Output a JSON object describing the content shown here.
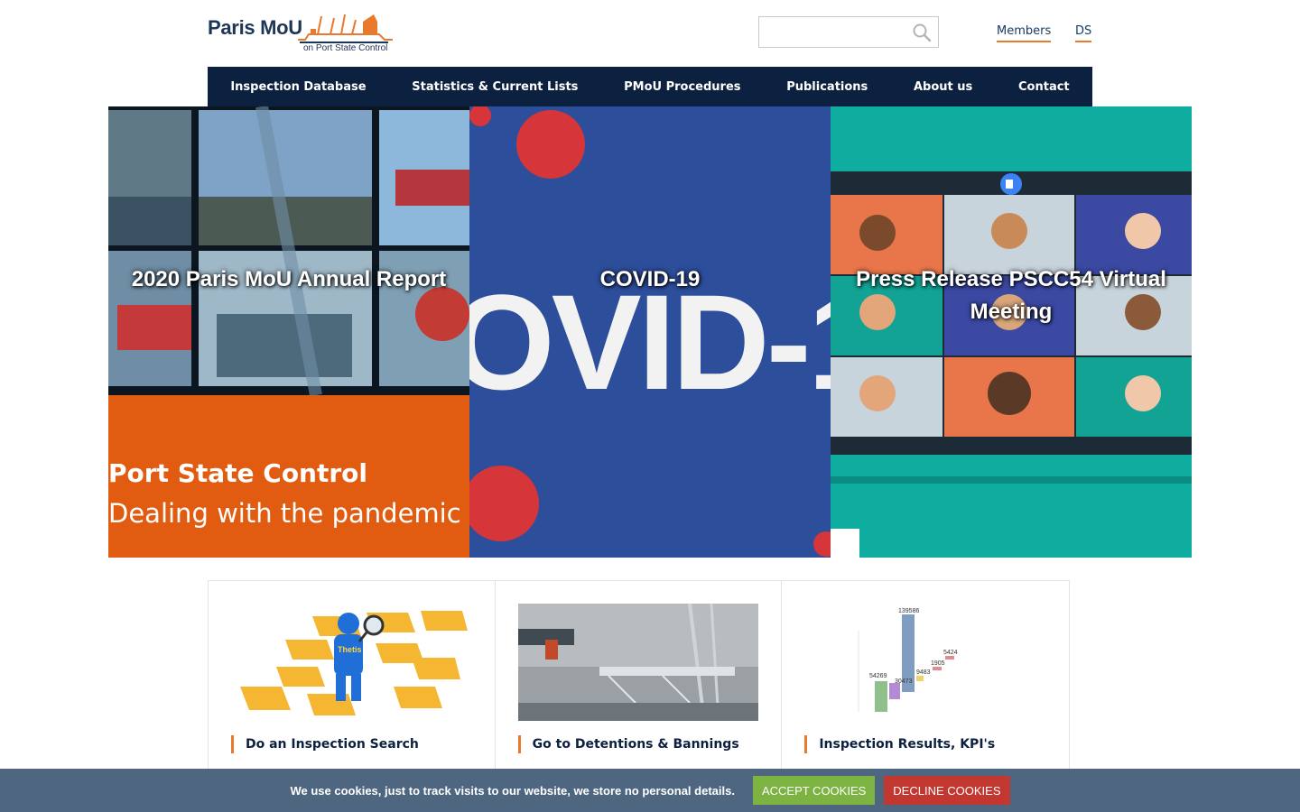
{
  "header": {
    "logo_title": "Paris MoU",
    "logo_subtitle": "on Port State Control",
    "search": {
      "placeholder": "",
      "value": ""
    },
    "links": {
      "members": "Members",
      "ds": "DS"
    }
  },
  "nav": {
    "items": [
      "Inspection Database",
      "Statistics & Current Lists",
      "PMoU Procedures",
      "Publications",
      "About us",
      "Contact"
    ]
  },
  "hero": {
    "tiles": [
      {
        "caption": "2020 Paris MoU Annual Report",
        "image_text_1": "Port State Control",
        "image_text_2": "Dealing with the pandemic"
      },
      {
        "caption": "COVID-19",
        "image_text": "OVID-1"
      },
      {
        "caption": "Press Release PSCC54 Virtual Meeting"
      }
    ]
  },
  "cards": [
    {
      "title": "Do an Inspection Search",
      "image_label": "Thetis"
    },
    {
      "title": "Go to Detentions & Bannings"
    },
    {
      "title": "Inspection Results, KPI's",
      "chart_values": [
        "139586",
        "54269",
        "30473",
        "9483",
        "1905",
        "5424"
      ]
    }
  ],
  "cookie": {
    "message": "We use cookies, just to track visits to our website, we store no personal details.",
    "accept": "ACCEPT COOKIES",
    "decline": "DECLINE COOKIES"
  },
  "colors": {
    "navy": "#0c2140",
    "accent_orange": "#e8792d",
    "accept_green": "#7cb342",
    "decline_red": "#c2372f"
  }
}
